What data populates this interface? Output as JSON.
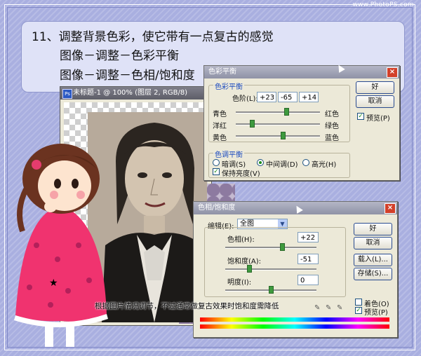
{
  "watermark": "www.PhotoPS.com",
  "title": {
    "line1": "11、调整背景色彩，使它带有一点复古的感觉",
    "line2": "图像－调整－色彩平衡",
    "line3": "图像－调整－色相/饱和度"
  },
  "document": {
    "title": "未标题-1 @ 100% (图层 2, RGB/8)"
  },
  "color_balance": {
    "title": "色彩平衡",
    "group1_title": "色彩平衡",
    "levels_label": "色阶(L):",
    "level1": "+23",
    "level2": "-65",
    "level3": "+14",
    "sliders": [
      {
        "left": "青色",
        "right": "红色",
        "value": 23
      },
      {
        "left": "洋红",
        "right": "绿色",
        "value": -65
      },
      {
        "left": "黄色",
        "right": "蓝色",
        "value": 14
      }
    ],
    "group2_title": "色调平衡",
    "shadows": "暗调(S)",
    "midtones": "中间调(D)",
    "highlights": "高光(H)",
    "preserve": "保持亮度(V)",
    "ok": "好",
    "cancel": "取消",
    "preview": "预览(P)"
  },
  "hue_sat": {
    "title": "色相/饱和度",
    "edit_label": "编辑(E):",
    "edit_value": "全图",
    "hue_label": "色相(H):",
    "hue_value": "+22",
    "sat_label": "饱和度(A):",
    "sat_value": "-51",
    "light_label": "明度(I):",
    "light_value": "0",
    "ok": "好",
    "cancel": "取消",
    "load": "载入(L)...",
    "save": "存储(S)...",
    "colorize": "着色(O)",
    "preview": "预览(P)"
  },
  "caption": "根据图片情况调节，不过通常做复古效果时饱和度需降低",
  "colors": {
    "accent": "#1c4bbf",
    "slider": "#3e9a3e",
    "close": "#d2402a"
  }
}
